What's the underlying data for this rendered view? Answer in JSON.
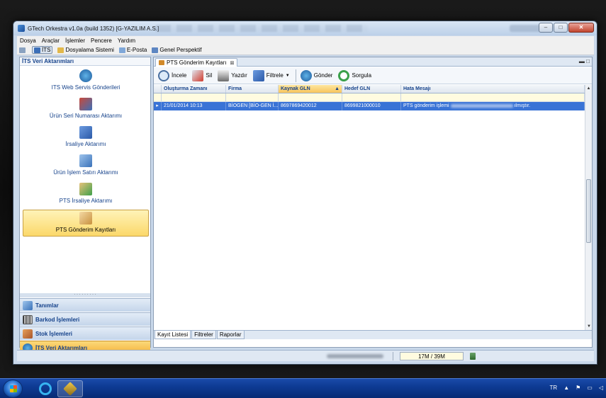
{
  "window": {
    "title": "GTech Orkestra v1.0a (build 1352) [G-YAZILIM A.S.]"
  },
  "menu": [
    "Dosya",
    "Araçlar",
    "İşlemler",
    "Pencere",
    "Yardım"
  ],
  "perspectives": {
    "its": "İTS",
    "dosyalama": "Dosyalama Sistemi",
    "eposta": "E-Posta",
    "genel": "Genel Perspektif"
  },
  "left_panel": {
    "header": "İTS Veri Aktarımları",
    "items": [
      {
        "label": "ITS Web Servis Gönderileri",
        "icon": "globe-icon"
      },
      {
        "label": "Ürün Seri Numarası Aktarımı",
        "icon": "serial-icon"
      },
      {
        "label": "İrsaliye Aktarımı",
        "icon": "waybill-icon"
      },
      {
        "label": "Ürün İşlem Satırı Aktarımı",
        "icon": "document-icon"
      },
      {
        "label": "PTS İrsaliye Aktarımı",
        "icon": "box-arrow-icon"
      },
      {
        "label": "PTS Gönderim Kayıtları",
        "icon": "box-icon",
        "selected": true
      }
    ],
    "nav": [
      {
        "label": "Tanımlar",
        "icon": "definitions-icon"
      },
      {
        "label": "Barkod İşlemleri",
        "icon": "barcode-icon"
      },
      {
        "label": "Stok İşlemleri",
        "icon": "stock-icon"
      },
      {
        "label": "İTS Veri Aktarımları",
        "icon": "globe-icon",
        "active": true
      }
    ]
  },
  "document_tab": {
    "label": "PTS Gönderim Kayıtları",
    "close": "⊠"
  },
  "toolbar": {
    "incele": "İncele",
    "sil": "Sil",
    "yazdir": "Yazdır",
    "filtrele": "Filtrele",
    "gonder": "Gönder",
    "sorgula": "Sorgula"
  },
  "grid": {
    "columns": [
      "Oluşturma Zamanı",
      "Firma",
      "Kaynak GLN",
      "Hedef GLN",
      "Hata Mesajı"
    ],
    "sorted_column": "Kaynak GLN",
    "rows": [
      {
        "indicator": "▸",
        "olusturma": "21/01/2014 10:13",
        "firma": "BİOGEN [BİO-GEN İ...",
        "kaynak_gln": "8697869420012",
        "hedef_gln": "8699821000010",
        "hata_prefix": "PTS gönderim işlemi",
        "hata_suffix": "ılmıştır."
      }
    ]
  },
  "bottom_tabs": [
    "Kayıt Listesi",
    "Filtreler",
    "Raporlar"
  ],
  "statusbar": {
    "memory": "17M / 39M"
  },
  "taskbar": {
    "language": "TR"
  },
  "colors": {
    "selection": "#3973d6",
    "accent": "#15428b",
    "highlight": "#fbd86a"
  }
}
